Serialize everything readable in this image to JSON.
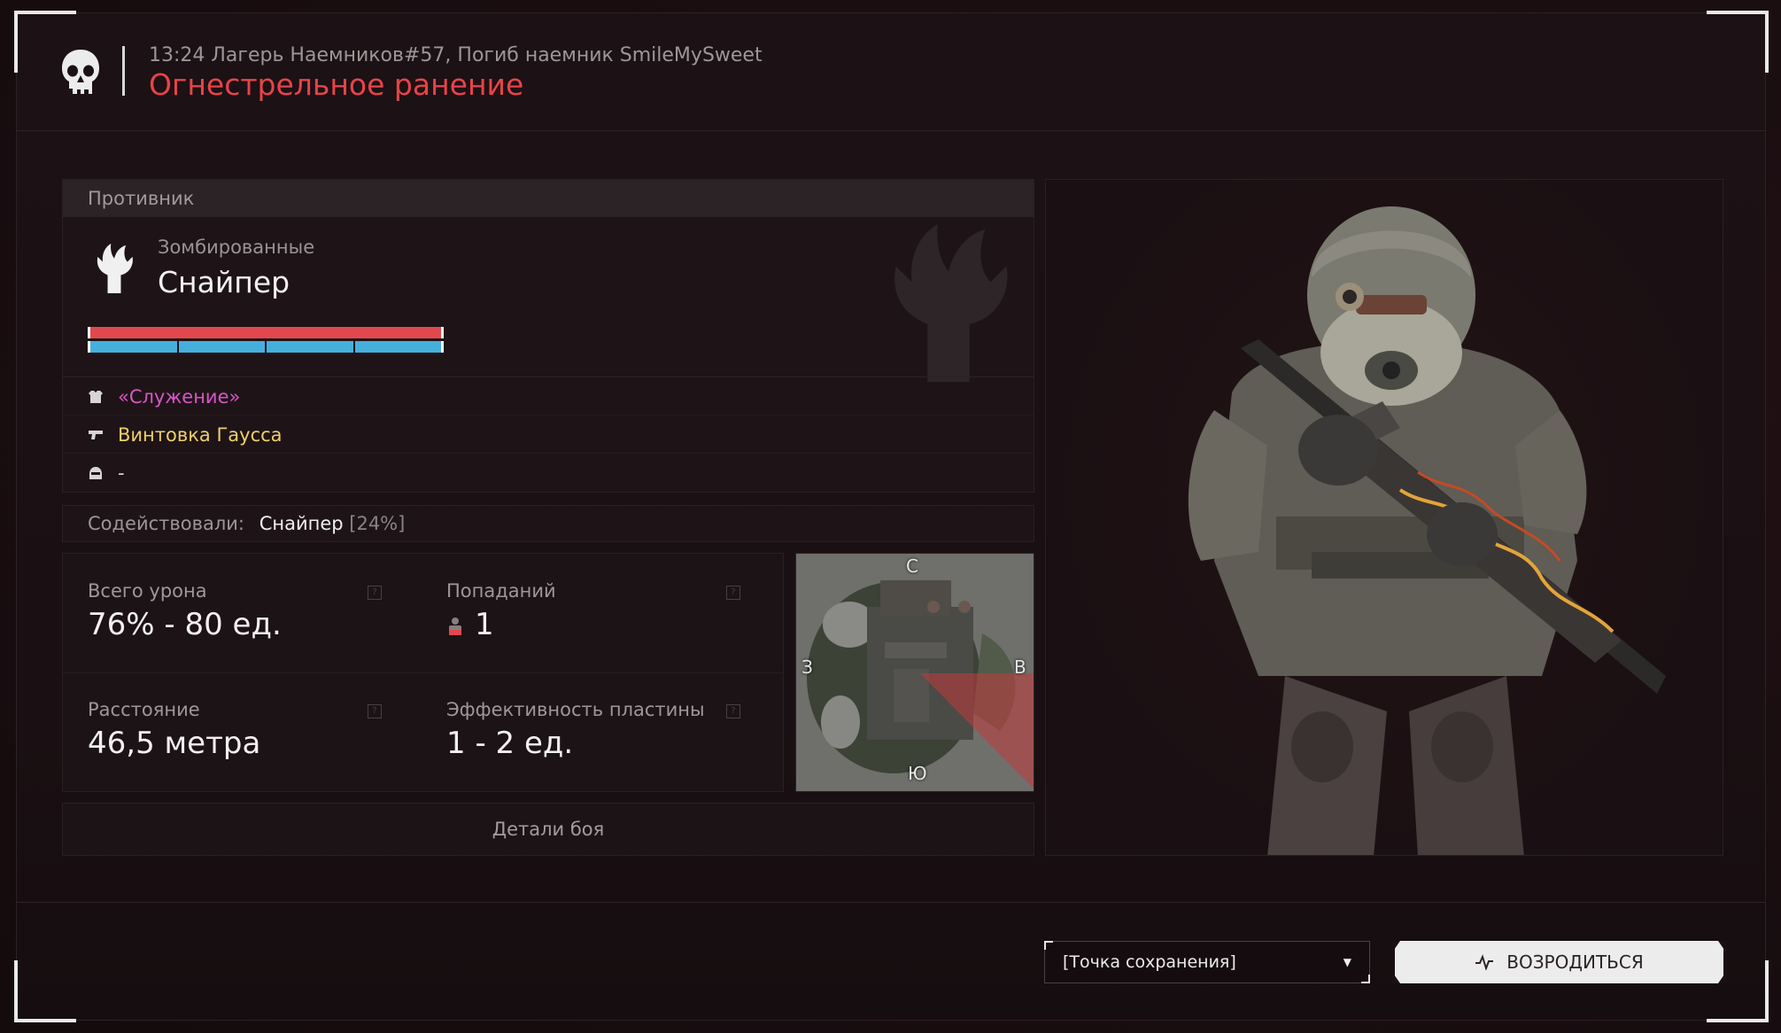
{
  "header": {
    "event_line": "13:24 Лагерь Наемников#57, Погиб наемник SmileMySweet",
    "title": "Огнестрельное ранение"
  },
  "enemy": {
    "section_label": "Противник",
    "faction": "Зомбированные",
    "name": "Снайпер",
    "health_fraction": 1.0,
    "armor_fraction": 1.0,
    "armor_segments": 4,
    "equipment": [
      {
        "icon": "armor-icon",
        "text": "«Служение»",
        "color": "#d855c8"
      },
      {
        "icon": "gun-icon",
        "text": "Винтовка Гаусса",
        "color": "#efcf6a"
      },
      {
        "icon": "helmet-icon",
        "text": "-",
        "color": "#d8d4d4"
      }
    ]
  },
  "assist": {
    "label": "Содействовали:",
    "name": "Снайпер",
    "percent": "[24%]"
  },
  "stats": {
    "total_damage_label": "Всего урона",
    "total_damage_value": "76% - 80 ед.",
    "hits_label": "Попаданий",
    "hits_value": "1",
    "distance_label": "Расстояние",
    "distance_value": "46,5 метра",
    "plate_label": "Эффективность пластины",
    "plate_value": "1 - 2 ед.",
    "help_glyph": "?"
  },
  "minimap": {
    "north": "С",
    "south": "Ю",
    "west": "З",
    "east": "В"
  },
  "details_button": "Детали боя",
  "footer": {
    "spawn_point": "[Точка сохранения]",
    "respawn_label": "ВОЗРОДИТЬСЯ"
  },
  "colors": {
    "accent_red": "#e8434a",
    "health": "#e0484d",
    "armor": "#45b0de",
    "armor_item": "#d855c8",
    "weapon_item": "#efcf6a"
  }
}
